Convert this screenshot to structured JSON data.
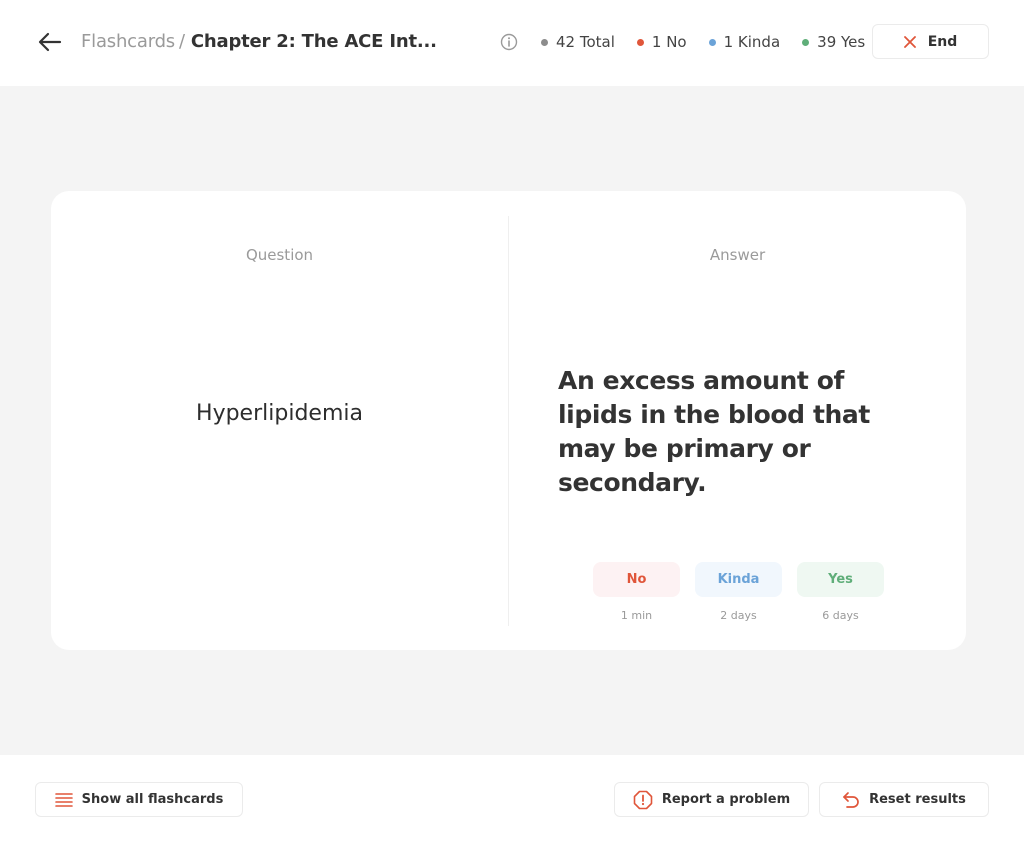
{
  "header": {
    "breadcrumb_parent": "Flashcards",
    "breadcrumb_separator": "/",
    "breadcrumb_current": "Chapter 2: The ACE Int...",
    "stats": [
      {
        "label": "42 Total",
        "color": "#8c8c8c"
      },
      {
        "label": "1 No",
        "color": "#e0563a"
      },
      {
        "label": "1 Kinda",
        "color": "#6ba3d8"
      },
      {
        "label": "39 Yes",
        "color": "#5fae79"
      }
    ],
    "end_label": "End"
  },
  "card": {
    "question_label": "Question",
    "answer_label": "Answer",
    "term": "Hyperlipidemia",
    "definition": "An excess amount of lipids in the blood that may be primary or secondary.",
    "ratings": [
      {
        "label": "No",
        "interval": "1 min",
        "color": "#e0563a"
      },
      {
        "label": "Kinda",
        "interval": "2 days",
        "color": "#6ba3d8"
      },
      {
        "label": "Yes",
        "interval": "6 days",
        "color": "#5fae79"
      }
    ]
  },
  "footer": {
    "show_all_label": "Show all flashcards",
    "report_label": "Report a problem",
    "reset_label": "Reset results"
  },
  "icons": {
    "back": "arrow-left-icon",
    "info": "info-icon",
    "end": "close-icon",
    "list": "list-icon",
    "report": "alert-octagon-icon",
    "reset": "undo-icon"
  },
  "accent_color": "#e0563a"
}
